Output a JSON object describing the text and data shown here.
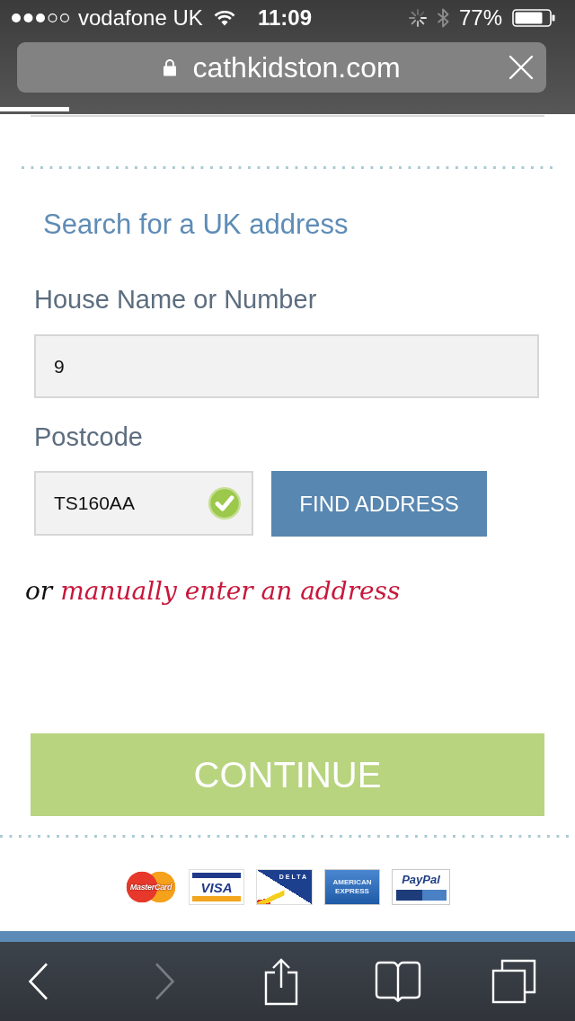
{
  "status_bar": {
    "carrier": "vodafone UK",
    "time": "11:09",
    "battery": "77%"
  },
  "browser": {
    "url": "cathkidston.com",
    "page_load": {
      "level": 0.12
    }
  },
  "address_search": {
    "title": "Search for a UK address",
    "house_number": {
      "label": "House Name or Number",
      "value": "9"
    },
    "postcode": {
      "label": "Postcode",
      "value": "TS160AA",
      "valid": true
    },
    "find_button": "FIND ADDRESS",
    "manual_entry": {
      "prefix": "or",
      "link": "manually enter an address"
    }
  },
  "continue_button": "CONTINUE",
  "payment_methods": [
    {
      "kind": "mastercard",
      "label": "MasterCard"
    },
    {
      "kind": "visa",
      "label": "VISA"
    },
    {
      "kind": "delta",
      "label": "DELTA"
    },
    {
      "kind": "amex",
      "label": "AMERICAN EXPRESS"
    },
    {
      "kind": "paypal",
      "label": "PayPal"
    }
  ],
  "toolbar": [
    {
      "kind": "back",
      "disabled": false
    },
    {
      "kind": "forward",
      "disabled": true
    },
    {
      "kind": "share",
      "disabled": false
    },
    {
      "kind": "bookmarks",
      "disabled": false
    },
    {
      "kind": "tabs",
      "disabled": false
    }
  ]
}
